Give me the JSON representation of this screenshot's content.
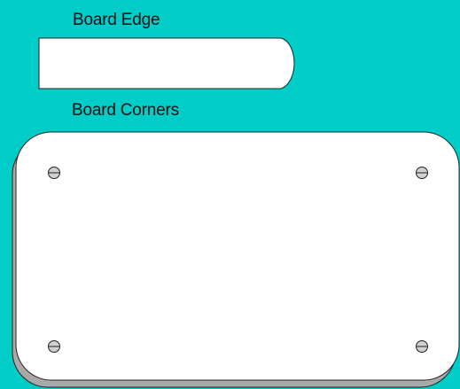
{
  "labels": {
    "board_edge": "Board Edge",
    "board_corners": "Board Corners"
  },
  "colors": {
    "background": "#00cdc8",
    "board_fill": "#ffffff",
    "board_shadow": "#a9a9a9",
    "outline": "#222222",
    "screw_fill": "#d0d0d0"
  },
  "icons": [
    "screw-icon"
  ]
}
